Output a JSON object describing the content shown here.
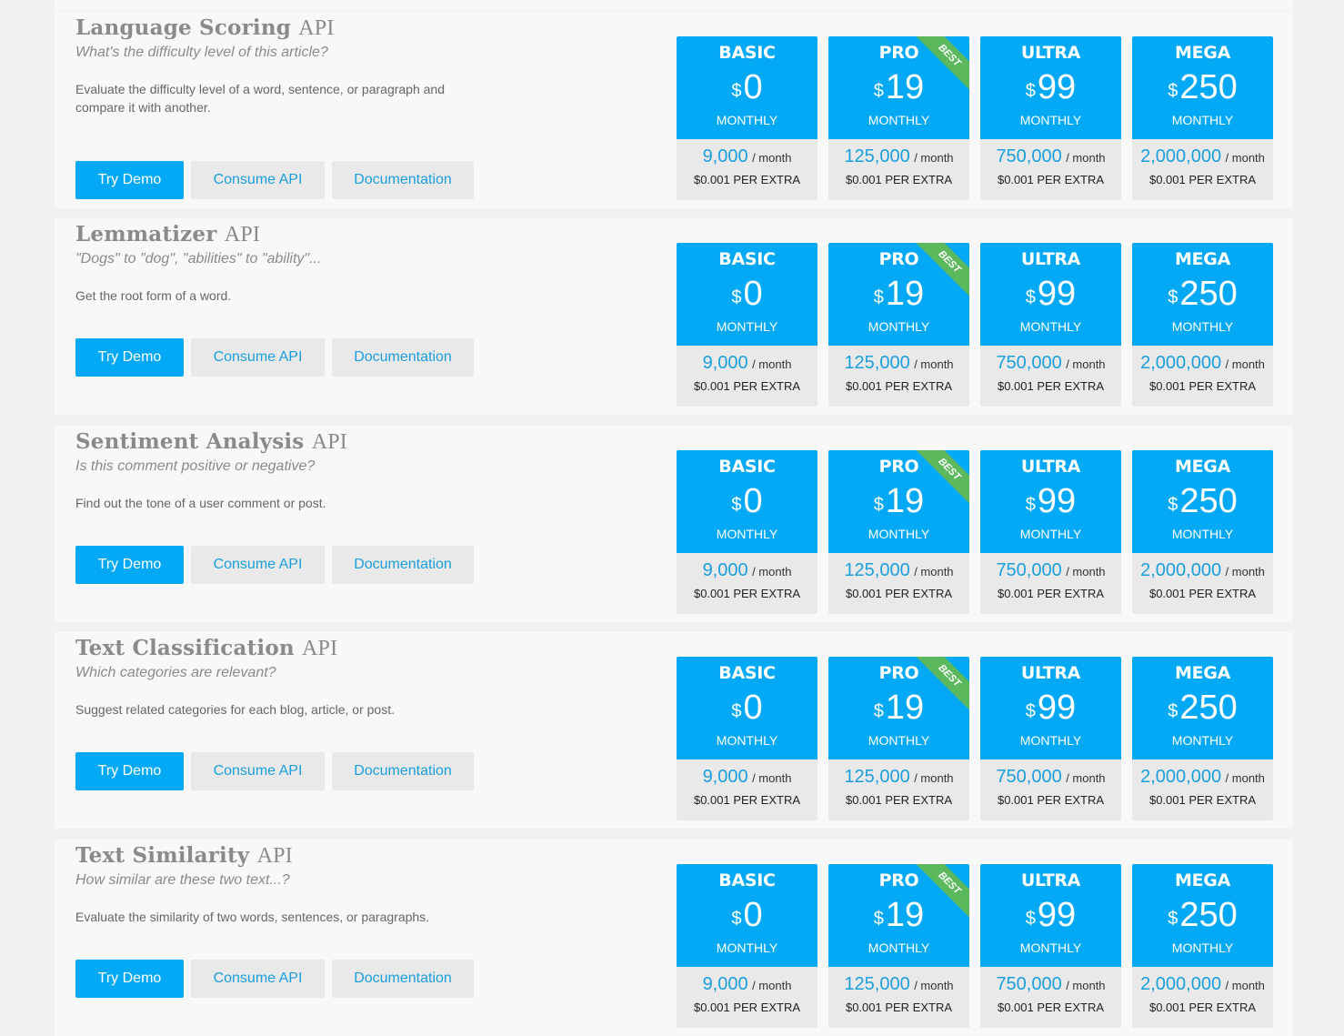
{
  "plans": [
    {
      "name": "BASIC",
      "currency": "$",
      "price": "0",
      "period": "MONTHLY",
      "quota": "9,000",
      "unit": "/ month",
      "extra": "$0.001 PER EXTRA",
      "badge": ""
    },
    {
      "name": "PRO",
      "currency": "$",
      "price": "19",
      "period": "MONTHLY",
      "quota": "125,000",
      "unit": "/ month",
      "extra": "$0.001 PER EXTRA",
      "badge": "BEST"
    },
    {
      "name": "ULTRA",
      "currency": "$",
      "price": "99",
      "period": "MONTHLY",
      "quota": "750,000",
      "unit": "/ month",
      "extra": "$0.001 PER EXTRA",
      "badge": ""
    },
    {
      "name": "MEGA",
      "currency": "$",
      "price": "250",
      "period": "MONTHLY",
      "quota": "2,000,000",
      "unit": "/ month",
      "extra": "$0.001 PER EXTRA",
      "badge": ""
    }
  ],
  "apis": [
    {
      "title": "Language Scoring",
      "suffix": "API",
      "tagline": "What's the difficulty level of this article?",
      "description": "Evaluate the difficulty level of a word, sentence, or paragraph and compare it with another.",
      "buttons": {
        "demo": "Try Demo",
        "consume": "Consume API",
        "docs": "Documentation"
      }
    },
    {
      "title": "Lemmatizer",
      "suffix": "API",
      "tagline": "\"Dogs\" to \"dog\", \"abilities\" to \"ability\"...",
      "description": "Get the root form of a word.",
      "buttons": {
        "demo": "Try Demo",
        "consume": "Consume API",
        "docs": "Documentation"
      }
    },
    {
      "title": "Sentiment Analysis",
      "suffix": "API",
      "tagline": "Is this comment positive or negative?",
      "description": "Find out the tone of a user comment or post.",
      "buttons": {
        "demo": "Try Demo",
        "consume": "Consume API",
        "docs": "Documentation"
      }
    },
    {
      "title": "Text Classification",
      "suffix": "API",
      "tagline": "Which categories are relevant?",
      "description": "Suggest related categories for each blog, article, or post.",
      "buttons": {
        "demo": "Try Demo",
        "consume": "Consume API",
        "docs": "Documentation"
      }
    },
    {
      "title": "Text Similarity",
      "suffix": "API",
      "tagline": "How similar are these two text...?",
      "description": "Evaluate the similarity of two words, sentences, or paragraphs.",
      "buttons": {
        "demo": "Try Demo",
        "consume": "Consume API",
        "docs": "Documentation"
      }
    }
  ]
}
